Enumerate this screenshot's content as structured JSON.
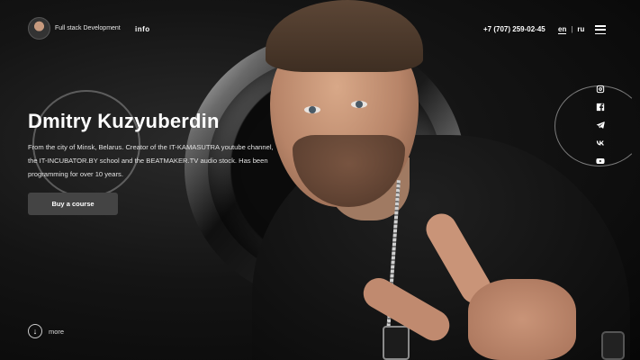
{
  "header": {
    "tagline": "Full stack Development",
    "nav_info": "info",
    "phone": "+7 (707) 259-02-45",
    "lang_en": "en",
    "lang_separator": "|",
    "lang_ru": "ru"
  },
  "hero": {
    "title": "Dmitry Kuzyuberdin",
    "description": "From the city of Minsk, Belarus. Creator of the IT-KAMASUTRA youtube channel, the IT-INCUBATOR.BY school and the BEATMAKER.TV audio stock. Has been programming for over 10 years.",
    "cta_label": "Buy a course"
  },
  "more": {
    "icon": "arrow-down-icon",
    "label": "more"
  },
  "social": {
    "items": [
      "instagram-icon",
      "facebook-icon",
      "telegram-icon",
      "vk-icon",
      "youtube-icon"
    ]
  },
  "colors": {
    "background": "#0d0d0d",
    "button": "#444444",
    "text": "#ffffff"
  }
}
